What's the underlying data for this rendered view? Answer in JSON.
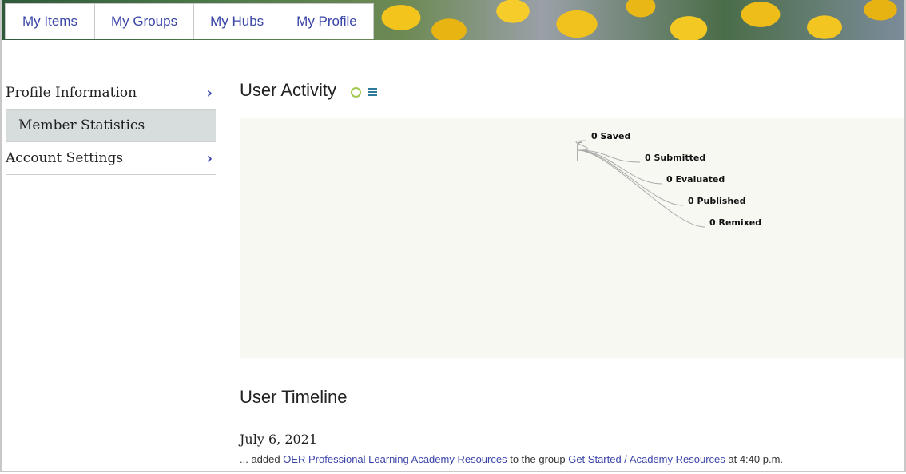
{
  "tabs": [
    "My Items",
    "My Groups",
    "My Hubs",
    "My Profile"
  ],
  "sidebar": {
    "items": [
      {
        "label": "Profile Information",
        "icon": "chevron-right-icon"
      },
      {
        "label": "Member Statistics"
      },
      {
        "label": "Account Settings",
        "icon": "chevron-right-icon"
      }
    ]
  },
  "activity": {
    "title": "User Activity",
    "icons": [
      "circle-icon",
      "menu-icon"
    ]
  },
  "chart_data": {
    "type": "tree",
    "nodes": [
      {
        "label": "0 Saved",
        "value": 0
      },
      {
        "label": "0 Submitted",
        "value": 0
      },
      {
        "label": "0 Evaluated",
        "value": 0
      },
      {
        "label": "0 Published",
        "value": 0
      },
      {
        "label": "0 Remixed",
        "value": 0
      }
    ]
  },
  "timeline": {
    "title": "User Timeline",
    "date": "July 6, 2021",
    "entry": {
      "prefix": "... added ",
      "link1": "OER Professional Learning Academy Resources",
      "middle": " to the group ",
      "link2": "Get Started / Academy Resources",
      "suffix": " at 4:40 p.m."
    }
  },
  "colors": {
    "link": "#3a45a8",
    "active_bg": "#d7dcdc",
    "chart_bg": "#f8f8f3",
    "circle_icon": "#a4c84d",
    "menu_icon": "#2d7a9a"
  }
}
